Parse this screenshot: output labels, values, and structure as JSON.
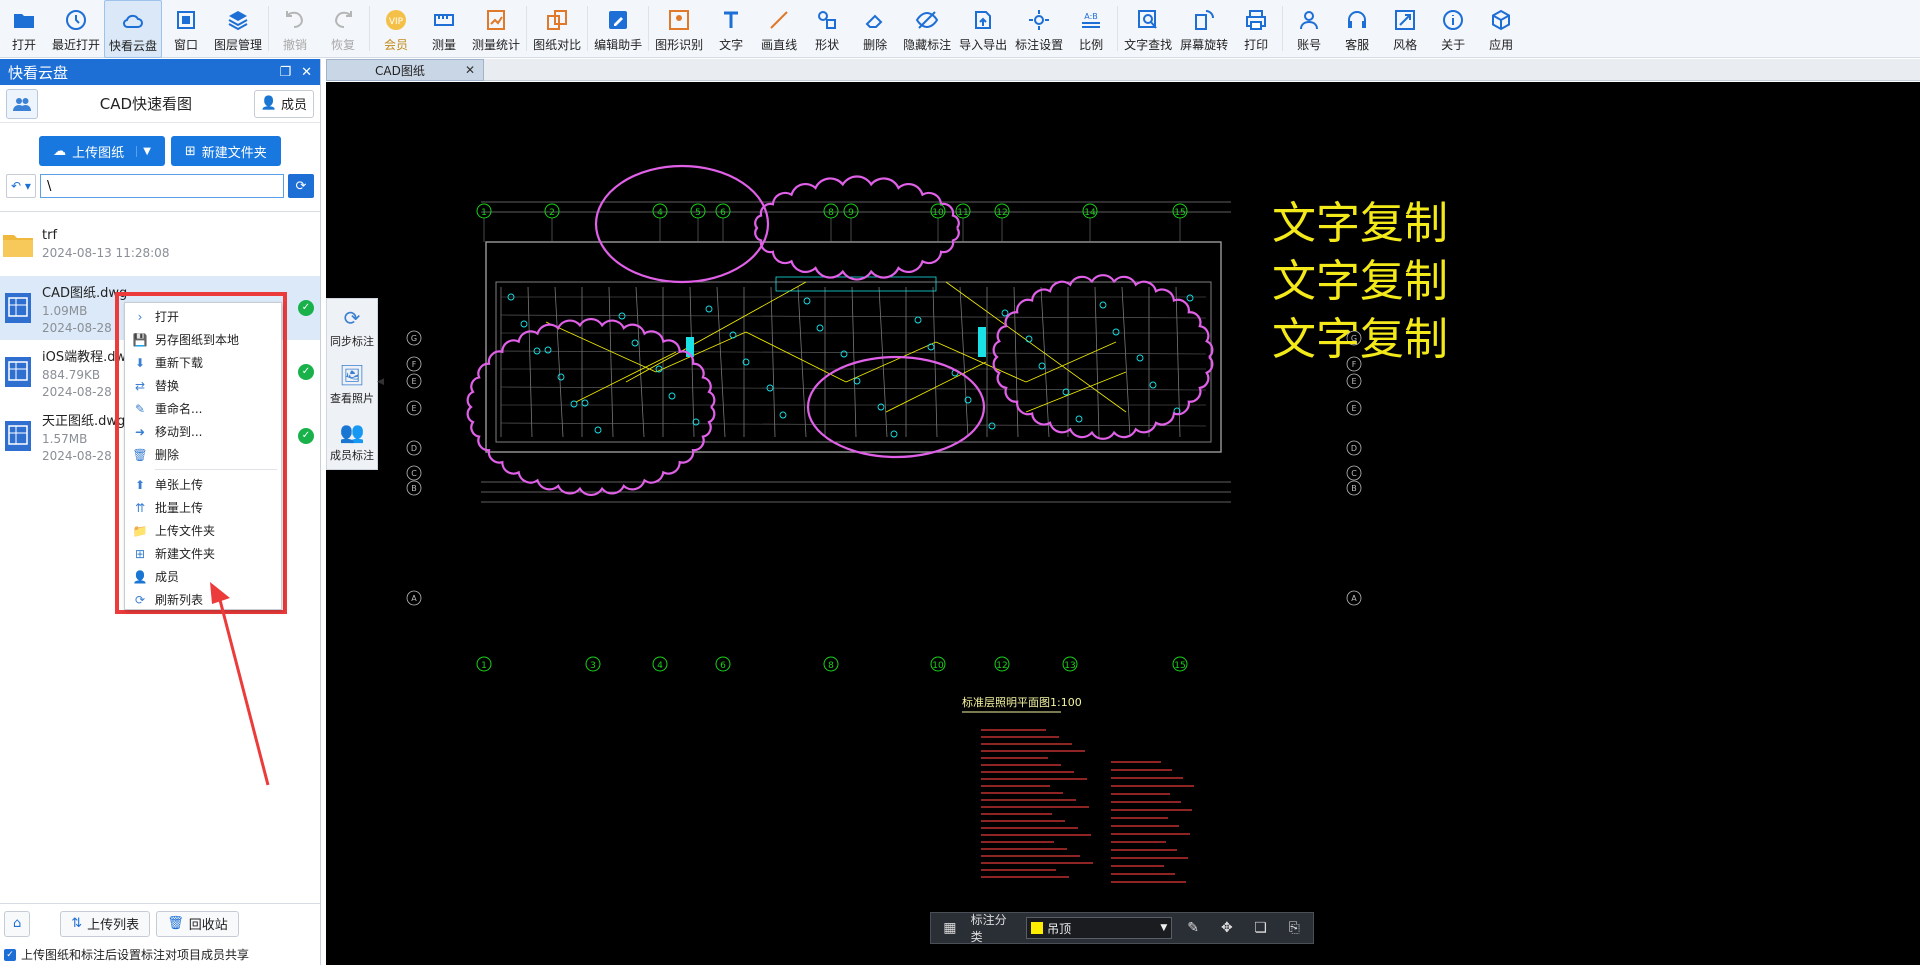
{
  "toolbar": {
    "items": [
      {
        "label": "打开",
        "icon": "folder-open-icon"
      },
      {
        "label": "最近打开",
        "icon": "recent-icon"
      },
      {
        "label": "快看云盘",
        "icon": "cloud-icon"
      },
      {
        "label": "窗口",
        "icon": "window-icon"
      },
      {
        "label": "图层管理",
        "icon": "layers-icon"
      },
      {
        "label": "撤销",
        "icon": "undo-icon"
      },
      {
        "label": "恢复",
        "icon": "redo-icon"
      },
      {
        "label": "会员",
        "icon": "vip-icon"
      },
      {
        "label": "测量",
        "icon": "measure-icon"
      },
      {
        "label": "测量统计",
        "icon": "measure-stats-icon"
      },
      {
        "label": "图纸对比",
        "icon": "compare-icon"
      },
      {
        "label": "编辑助手",
        "icon": "edit-assistant-icon"
      },
      {
        "label": "图形识别",
        "icon": "shape-recognize-icon"
      },
      {
        "label": "文字",
        "icon": "text-icon"
      },
      {
        "label": "画直线",
        "icon": "line-icon"
      },
      {
        "label": "形状",
        "icon": "shape-icon"
      },
      {
        "label": "删除",
        "icon": "eraser-icon"
      },
      {
        "label": "隐藏标注",
        "icon": "hide-markup-icon"
      },
      {
        "label": "导入导出",
        "icon": "import-export-icon"
      },
      {
        "label": "标注设置",
        "icon": "markup-settings-icon"
      },
      {
        "label": "比例",
        "icon": "scale-icon"
      },
      {
        "label": "文字查找",
        "icon": "text-search-icon"
      },
      {
        "label": "屏幕旋转",
        "icon": "rotate-screen-icon"
      },
      {
        "label": "打印",
        "icon": "printer-icon"
      },
      {
        "label": "账号",
        "icon": "account-icon"
      },
      {
        "label": "客服",
        "icon": "headset-icon"
      },
      {
        "label": "风格",
        "icon": "style-icon"
      },
      {
        "label": "关于",
        "icon": "info-icon"
      },
      {
        "label": "应用",
        "icon": "apps-icon"
      }
    ],
    "collapse_glyph": "▲"
  },
  "panel": {
    "title": "快看云盘",
    "header_title": "CAD快速看图",
    "member_label": "成员",
    "upload_label": "上传图纸",
    "new_folder_label": "新建文件夹",
    "path_value": "\\",
    "files": [
      {
        "name": "trf",
        "meta": "2024-08-13 11:28:08",
        "type": "folder"
      },
      {
        "name": "CAD图纸.dwg",
        "size": "1.09MB",
        "meta": "2024-08-28",
        "type": "dwg",
        "synced": true
      },
      {
        "name": "iOS端教程.dwg",
        "size": "884.79KB",
        "meta": "2024-08-28",
        "type": "dwg",
        "synced": true
      },
      {
        "name": "天正图纸.dwg",
        "size": "1.57MB",
        "meta": "2024-08-28",
        "type": "dwg",
        "synced": true
      }
    ],
    "upload_list_label": "上传列表",
    "recycle_label": "回收站",
    "share_text": "上传图纸和标注后设置标注对项目成员共享"
  },
  "side_strip": {
    "items": [
      {
        "label": "同步标注",
        "icon": "sync-icon"
      },
      {
        "label": "查看照片",
        "icon": "photo-icon"
      },
      {
        "label": "成员标注",
        "icon": "members-icon"
      }
    ]
  },
  "context_menu": {
    "items": [
      {
        "label": "打开",
        "icon": "chevron-right-icon"
      },
      {
        "label": "另存图纸到本地",
        "icon": "save-icon"
      },
      {
        "label": "重新下载",
        "icon": "download-icon"
      },
      {
        "label": "替换",
        "icon": "replace-icon"
      },
      {
        "label": "重命名...",
        "icon": "rename-icon"
      },
      {
        "label": "移动到...",
        "icon": "move-icon"
      },
      {
        "label": "删除",
        "icon": "trash-icon"
      },
      {
        "label": "单张上传",
        "icon": "upload-icon"
      },
      {
        "label": "批量上传",
        "icon": "batch-upload-icon"
      },
      {
        "label": "上传文件夹",
        "icon": "upload-folder-icon"
      },
      {
        "label": "新建文件夹",
        "icon": "new-folder-icon"
      },
      {
        "label": "成员",
        "icon": "member-icon"
      },
      {
        "label": "刷新列表",
        "icon": "refresh-icon"
      }
    ]
  },
  "document": {
    "tab_label": "CAD图纸",
    "watermark_text": "文字复制",
    "drawing_title": "标准层照明平面图1:100",
    "column_top": [
      "1",
      "2",
      "4",
      "5",
      "6",
      "8",
      "9",
      "10",
      "11",
      "12",
      "14",
      "15"
    ],
    "column_bottom": [
      "1",
      "3",
      "4",
      "6",
      "8",
      "10",
      "12",
      "13",
      "15"
    ],
    "row_labels": [
      "G",
      "F",
      "E",
      "E",
      "D",
      "C",
      "B",
      "A"
    ]
  },
  "markbar": {
    "label": "标注分类",
    "category": "吊顶",
    "category_color": "#ffee00"
  },
  "colors": {
    "accent": "#1d6fd6",
    "highlight_red": "#ec3b3b",
    "cloud_magenta": "#e060e8",
    "grid_green": "#19d219",
    "wire_yellow": "#f4f000",
    "wire_cyan": "#19e1e6"
  }
}
